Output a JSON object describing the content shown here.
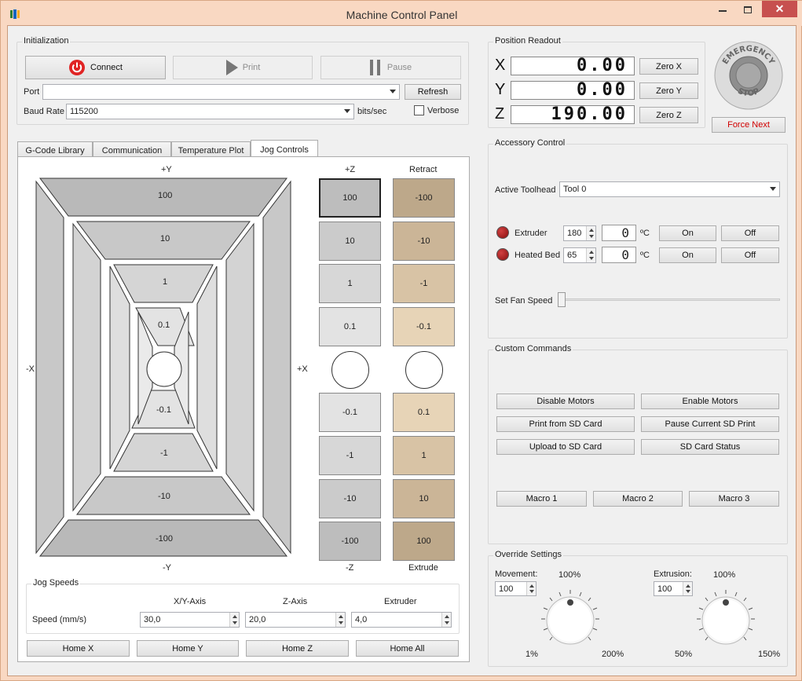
{
  "window": {
    "title": "Machine Control Panel"
  },
  "init": {
    "group_title": "Initialization",
    "connect": "Connect",
    "print": "Print",
    "pause": "Pause",
    "port_label": "Port",
    "port_value": "",
    "refresh": "Refresh",
    "baud_label": "Baud Rate",
    "baud_value": "115200",
    "baud_unit": "bits/sec",
    "verbose": "Verbose"
  },
  "tabs": [
    "G-Code Library",
    "Communication",
    "Temperature Plot",
    "Jog Controls"
  ],
  "jog": {
    "xy_labels": {
      "py": "+Y",
      "ny": "-Y",
      "nx": "-X",
      "px": "+X"
    },
    "y_steps": [
      "100",
      "10",
      "1",
      "0.1",
      "-0.1",
      "-1",
      "-10",
      "-100"
    ],
    "z_header": "+Z",
    "z_footer": "-Z",
    "z_steps": [
      "100",
      "10",
      "1",
      "0.1",
      "-0.1",
      "-1",
      "-10",
      "-100"
    ],
    "e_header": "Retract",
    "e_footer": "Extrude",
    "e_steps": [
      "-100",
      "-10",
      "-1",
      "-0.1",
      "0.1",
      "1",
      "10",
      "100"
    ],
    "speeds": {
      "group_title": "Jog Speeds",
      "row_label": "Speed (mm/s)",
      "col_xy": "X/Y-Axis",
      "col_z": "Z-Axis",
      "col_e": "Extruder",
      "xy": "30,0",
      "z": "20,0",
      "e": "4,0"
    },
    "home": [
      "Home X",
      "Home Y",
      "Home Z",
      "Home All"
    ]
  },
  "position": {
    "group_title": "Position Readout",
    "x_label": "X",
    "y_label": "Y",
    "z_label": "Z",
    "x": "0.00",
    "y": "0.00",
    "z": "190.00",
    "zero_x": "Zero X",
    "zero_y": "Zero Y",
    "zero_z": "Zero Z"
  },
  "estop": {
    "top": "EMERGENCY",
    "bottom": "STOP",
    "force_next": "Force Next"
  },
  "accessory": {
    "group_title": "Accessory Control",
    "toolhead_label": "Active Toolhead",
    "toolhead": "Tool 0",
    "extruder_label": "Extruder",
    "extruder_set": "180",
    "extruder_read": "0",
    "bed_label": "Heated Bed",
    "bed_set": "65",
    "bed_read": "0",
    "unit": "ºC",
    "on": "On",
    "off": "Off",
    "fan_label": "Set Fan Speed"
  },
  "custom": {
    "group_title": "Custom Commands",
    "buttons": [
      "Disable Motors",
      "Enable Motors",
      "Print from SD Card",
      "Pause Current SD Print",
      "Upload to SD Card",
      "SD Card Status"
    ],
    "macros": [
      "Macro 1",
      "Macro 2",
      "Macro 3"
    ]
  },
  "override": {
    "group_title": "Override Settings",
    "movement_label": "Movement:",
    "movement_value": "100",
    "movement_pct": "100%",
    "movement_min": "1%",
    "movement_max": "200%",
    "extrusion_label": "Extrusion:",
    "extrusion_value": "100",
    "extrusion_pct": "100%",
    "extrusion_min": "50%",
    "extrusion_max": "150%"
  },
  "colors": {
    "accent_red": "#e81123",
    "title_bg": "#f9d8c2",
    "force_next": "#d00000"
  }
}
